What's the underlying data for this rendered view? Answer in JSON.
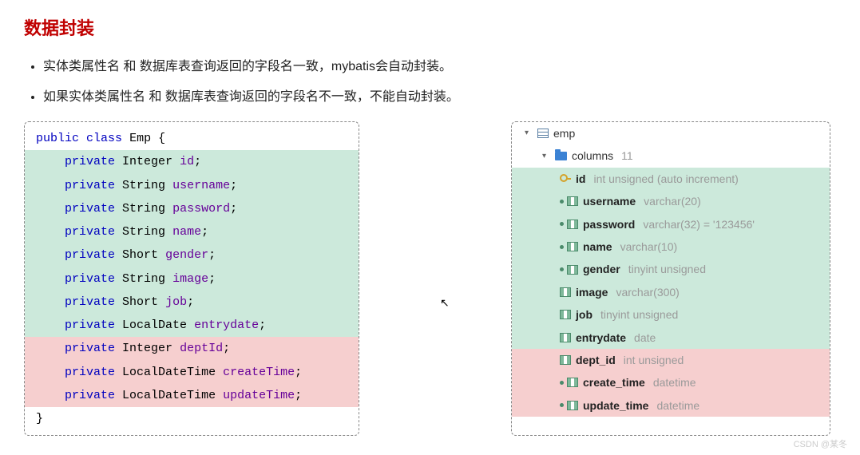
{
  "title": "数据封装",
  "bullets": [
    "实体类属性名 和 数据库表查询返回的字段名一致，mybatis会自动封装。",
    "如果实体类属性名 和 数据库表查询返回的字段名不一致，不能自动封装。"
  ],
  "code": {
    "declaration": {
      "kw1": "public",
      "kw2": "class",
      "name": "Emp",
      "open": " {"
    },
    "fields_match": [
      {
        "kw": "private",
        "type": "Integer",
        "name": "id"
      },
      {
        "kw": "private",
        "type": "String",
        "name": "username"
      },
      {
        "kw": "private",
        "type": "String",
        "name": "password"
      },
      {
        "kw": "private",
        "type": "String",
        "name": "name"
      },
      {
        "kw": "private",
        "type": "Short",
        "name": "gender"
      },
      {
        "kw": "private",
        "type": "String",
        "name": "image"
      },
      {
        "kw": "private",
        "type": "Short",
        "name": "job"
      },
      {
        "kw": "private",
        "type": "LocalDate",
        "name": "entrydate"
      }
    ],
    "fields_mismatch": [
      {
        "kw": "private",
        "type": "Integer",
        "name": "deptId"
      },
      {
        "kw": "private",
        "type": "LocalDateTime",
        "name": "createTime"
      },
      {
        "kw": "private",
        "type": "LocalDateTime",
        "name": "updateTime"
      }
    ],
    "close": "}"
  },
  "tree": {
    "table": "emp",
    "columns_label": "columns",
    "columns_count": "11",
    "columns_match": [
      {
        "icon": "key",
        "name": "id",
        "type": "int unsigned (auto increment)"
      },
      {
        "icon": "coldot",
        "name": "username",
        "type": "varchar(20)"
      },
      {
        "icon": "coldot",
        "name": "password",
        "type": "varchar(32) = '123456'"
      },
      {
        "icon": "coldot",
        "name": "name",
        "type": "varchar(10)"
      },
      {
        "icon": "coldot",
        "name": "gender",
        "type": "tinyint unsigned"
      },
      {
        "icon": "col",
        "name": "image",
        "type": "varchar(300)"
      },
      {
        "icon": "col",
        "name": "job",
        "type": "tinyint unsigned"
      },
      {
        "icon": "col",
        "name": "entrydate",
        "type": "date"
      }
    ],
    "columns_mismatch": [
      {
        "icon": "col",
        "name": "dept_id",
        "type": "int unsigned"
      },
      {
        "icon": "coldot",
        "name": "create_time",
        "type": "datetime"
      },
      {
        "icon": "coldot",
        "name": "update_time",
        "type": "datetime"
      }
    ]
  },
  "watermark": "CSDN @某冬"
}
